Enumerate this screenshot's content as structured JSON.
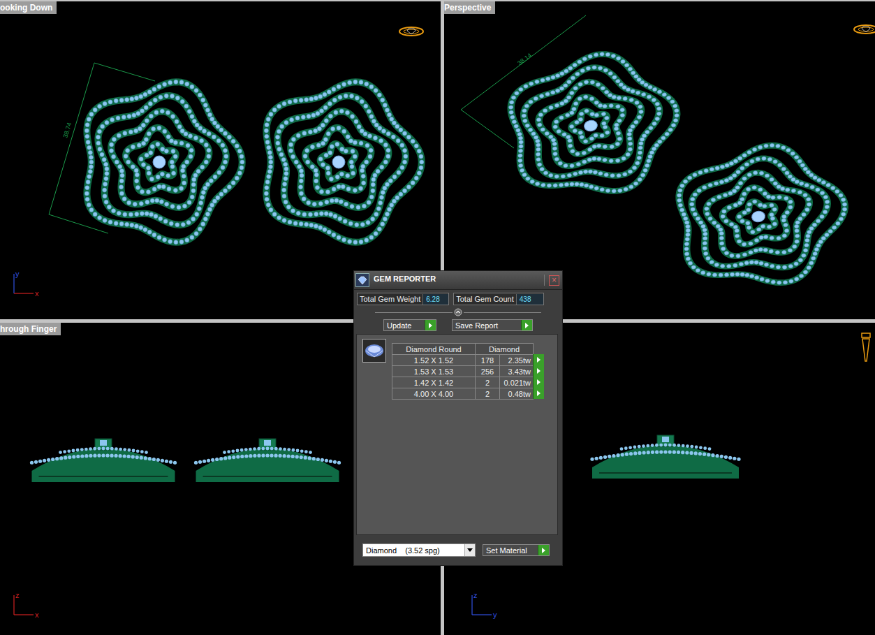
{
  "viewports": [
    {
      "label": "ooking Down",
      "kind": "top",
      "dimension": "38.74",
      "axes": [
        {
          "label": "y",
          "color": "#3050e0"
        },
        {
          "label": "x",
          "color": "#d02020"
        }
      ]
    },
    {
      "label": "Perspective",
      "kind": "perspective",
      "dimension": "38.14",
      "axes": []
    },
    {
      "label": "hrough Finger",
      "kind": "front",
      "axes": [
        {
          "label": "z",
          "color": "#d02020"
        },
        {
          "label": "x",
          "color": "#d02020"
        }
      ]
    },
    {
      "kind": "side",
      "axes": [
        {
          "label": "z",
          "color": "#3050e0"
        },
        {
          "label": "y",
          "color": "#3050e0"
        }
      ]
    }
  ],
  "gem_reporter": {
    "title": "GEM REPORTER",
    "close": "×",
    "total_weight_label": "Total Gem Weight",
    "total_weight": "6.28",
    "total_count_label": "Total Gem Count",
    "total_count": "438",
    "buttons": [
      "Update",
      "Save Report"
    ],
    "table": {
      "columns": [
        "Diamond Round",
        "Diamond"
      ],
      "rows": [
        {
          "size": "1.52 X 1.52",
          "count": "178",
          "weight": "2.35tw"
        },
        {
          "size": "1.53 X 1.53",
          "count": "256",
          "weight": "3.43tw"
        },
        {
          "size": "1.42 X 1.42",
          "count": "2",
          "weight": "0.021tw"
        },
        {
          "size": "4.00 X 4.00",
          "count": "2",
          "weight": "0.48tw"
        }
      ]
    },
    "material": "Diamond    (3.52 spg)",
    "set_material": "Set Material"
  }
}
